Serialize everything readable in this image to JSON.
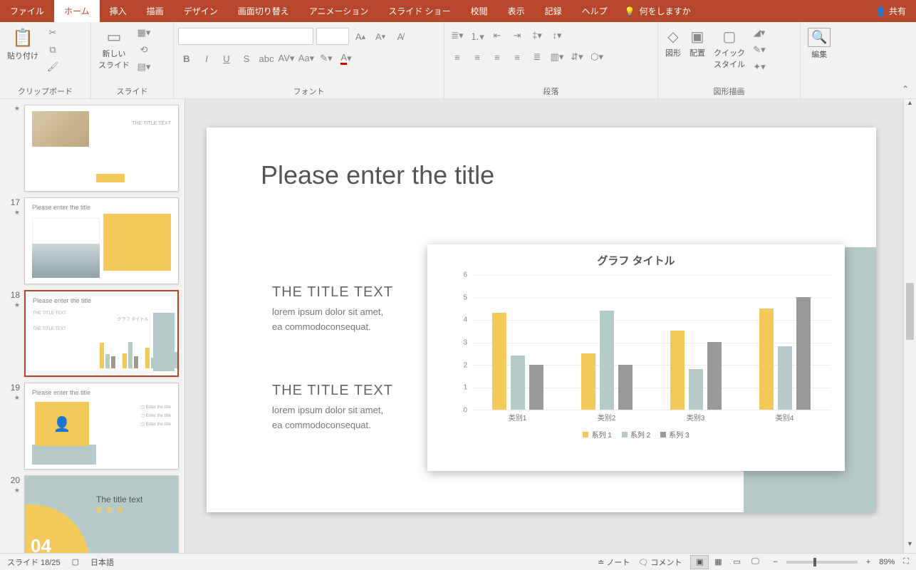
{
  "menu": {
    "file": "ファイル",
    "home": "ホーム",
    "insert": "挿入",
    "draw": "描画",
    "design": "デザイン",
    "transitions": "画面切り替え",
    "animations": "アニメーション",
    "slideshow": "スライド ショー",
    "review": "校閲",
    "view": "表示",
    "record": "記録",
    "help": "ヘルプ",
    "tell": "何をしますか",
    "share": "共有"
  },
  "ribbon": {
    "clipboard": {
      "paste": "貼り付け",
      "label": "クリップボード"
    },
    "slides": {
      "new": "新しい\nスライド",
      "label": "スライド"
    },
    "font": {
      "label": "フォント"
    },
    "paragraph": {
      "label": "段落"
    },
    "drawing": {
      "shapes": "図形",
      "arrange": "配置",
      "quick": "クイック\nスタイル",
      "label": "図形描画"
    },
    "editing": {
      "label": "編集"
    }
  },
  "thumbs": [
    {
      "num": "",
      "title": "THE TITLE TEXT",
      "kind": "t16"
    },
    {
      "num": "17",
      "title": "Please enter the title",
      "kind": "t17"
    },
    {
      "num": "18",
      "title": "Please enter the title",
      "kind": "t18",
      "selected": true
    },
    {
      "num": "19",
      "title": "Please enter the title",
      "kind": "t19"
    },
    {
      "num": "20",
      "title": "The title text",
      "kind": "t20"
    }
  ],
  "slide": {
    "title": "Please enter the title",
    "blocks": [
      {
        "head": "THE TITLE TEXT",
        "body": "lorem ipsum dolor sit amet,\nea commodoconsequat."
      },
      {
        "head": "THE TITLE TEXT",
        "body": "lorem ipsum dolor sit amet,\nea commodoconsequat."
      }
    ]
  },
  "chart_data": {
    "type": "bar",
    "title": "グラフ タイトル",
    "categories": [
      "类别1",
      "类别2",
      "类别3",
      "类别4"
    ],
    "series": [
      {
        "name": "系列 1",
        "color": "#f3c95c",
        "values": [
          4.3,
          2.5,
          3.5,
          4.5
        ]
      },
      {
        "name": "系列 2",
        "color": "#b5cbc9",
        "values": [
          2.4,
          4.4,
          1.8,
          2.8
        ]
      },
      {
        "name": "系列 3",
        "color": "#9a9a9a",
        "values": [
          2.0,
          2.0,
          3.0,
          5.0
        ]
      }
    ],
    "ylim": [
      0,
      6
    ],
    "yticks": [
      0,
      1,
      2,
      3,
      4,
      5,
      6
    ]
  },
  "status": {
    "slide": "スライド 18/25",
    "lang": "日本語",
    "notes": "ノート",
    "comments": "コメント",
    "zoom": "89%"
  }
}
